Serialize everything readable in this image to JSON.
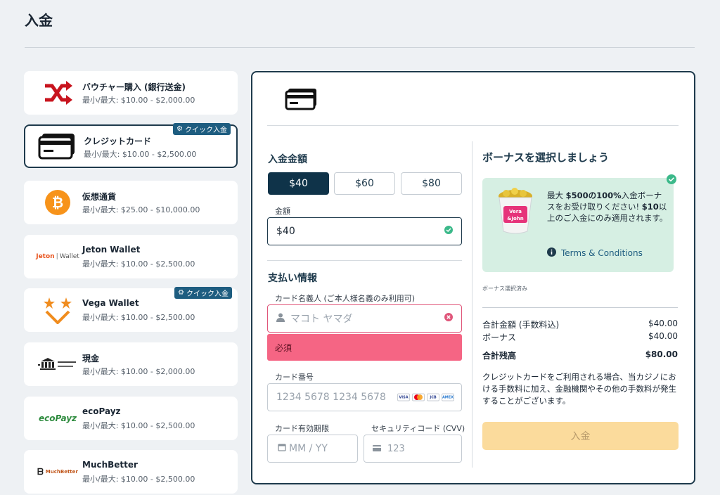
{
  "page": {
    "title": "入金"
  },
  "methods": [
    {
      "name": "バウチャー購入 (銀行送金)",
      "limits": "最小/最大: $10.00 - $2,000.00",
      "logo": "shuffle-arrows-icon"
    },
    {
      "name": "クレジットカード",
      "limits": "最小/最大: $10.00 - $2,500.00",
      "logo": "credit-card-icon",
      "badge": "クイック入金",
      "selected": true
    },
    {
      "name": "仮想通貨",
      "limits": "最小/最大: $25.00 - $10,000.00",
      "logo": "bitcoin-icon"
    },
    {
      "name": "Jeton Wallet",
      "limits": "最小/最大: $10.00 - $2,500.00",
      "logo": "jeton-logo",
      "logo_text": "Jeton",
      "logo_text2": "Wallet"
    },
    {
      "name": "Vega Wallet",
      "limits": "最小/最大: $10.00 - $2,500.00",
      "logo": "vega-wallet-logo",
      "badge": "クイック入金"
    },
    {
      "name": "現金",
      "limits": "最小/最大: $10.00 - $2,000.00",
      "logo": "bank-icon"
    },
    {
      "name": "ecoPayz",
      "limits": "最小/最大: $10.00 - $2,500.00",
      "logo": "ecopayz-logo",
      "logo_text": "ecoPayz"
    },
    {
      "name": "MuchBetter",
      "limits": "最小/最大: $10.00 - $2,500.00",
      "logo": "muchbetter-logo",
      "logo_text": "MuchBetter"
    }
  ],
  "form": {
    "amount_title": "入金金額",
    "amount_options": [
      "$40",
      "$60",
      "$80"
    ],
    "amount_label": "金額",
    "amount_value": "$40",
    "payment_title": "支払い情報",
    "cardholder_label": "カード名義人 (ご本人様名義のみ利用可)",
    "cardholder_placeholder": "マコト ヤマダ",
    "cardholder_error": "必須",
    "card_number_label": "カード番号",
    "card_number_placeholder": "1234 5678 1234 5678",
    "card_brands": [
      "VISA",
      "MC",
      "JCB",
      "AMEX"
    ],
    "expiry_label": "カード有効期限",
    "expiry_placeholder": "MM / YY",
    "cvv_label": "セキュリティコード (CVV)",
    "cvv_placeholder": "123"
  },
  "bonus": {
    "title": "ボーナスを選択しましょう",
    "text_prefix": "最大 ",
    "text_bold1": "$500の100%",
    "text_mid": "入金ボーナスをお受け取りください! ",
    "text_bold2": "$10",
    "text_suffix": "以上のご入金にのみ適用されます。",
    "terms_label": "Terms & Conditions",
    "selected_note": "ボーナス選択済み",
    "logo_text": "Vera&John"
  },
  "summary": {
    "total_label": "合計金額 (手数料込)",
    "total_value": "$40.00",
    "bonus_label": "ボーナス",
    "bonus_value": "$40.00",
    "balance_label": "合計残高",
    "balance_value": "$80.00",
    "fee_note": "クレジットカードをご利用される場合、当カジノにおける手数料に加え、金融機関やその他の手数料が発生することがございます。",
    "submit_label": "入金"
  },
  "colors": {
    "primary": "#0f3349",
    "badge": "#1e5d80",
    "error": "#f56584",
    "bonus_bg": "#d6efe3",
    "submit": "#fbdb9c"
  }
}
